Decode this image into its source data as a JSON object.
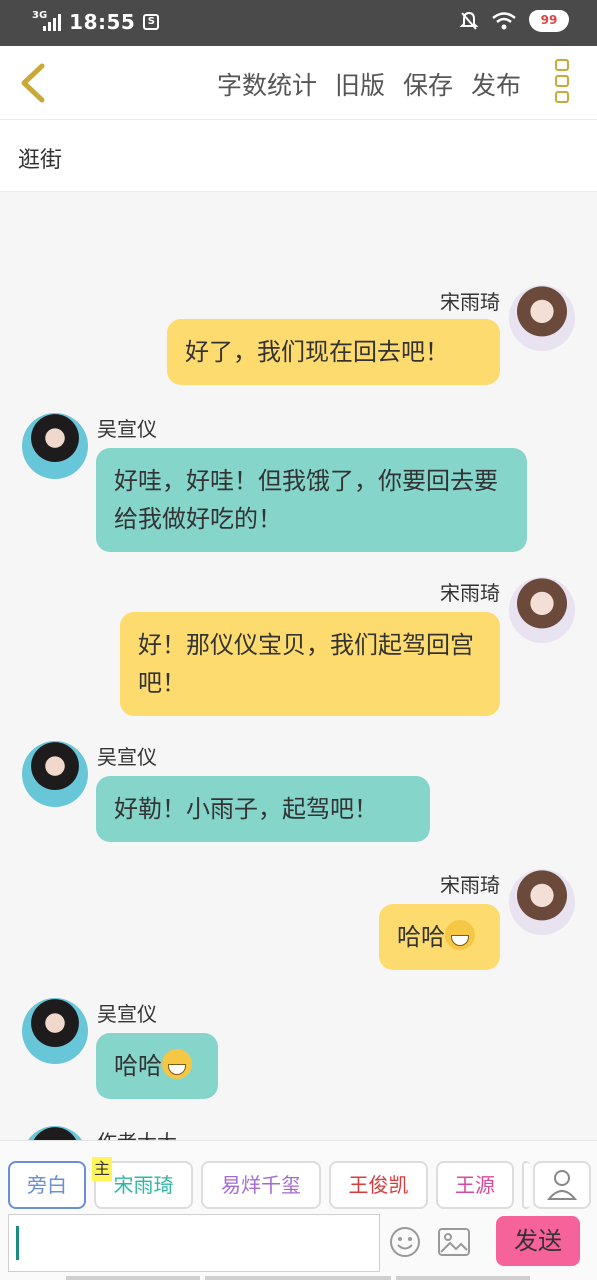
{
  "status_bar": {
    "network": "3G",
    "time": "18:55",
    "battery": "99"
  },
  "topbar": {
    "links": [
      "字数统计",
      "旧版",
      "保存",
      "发布"
    ]
  },
  "title": "逛街",
  "messages": [
    {
      "side": "right",
      "name": "宋雨琦",
      "text": "好了，我们现在回去吧！"
    },
    {
      "side": "left",
      "name": "吴宣仪",
      "text": "好哇，好哇！但我饿了，你要回去要给我做好吃的！"
    },
    {
      "side": "right",
      "name": "宋雨琦",
      "text": "好！那仪仪宝贝，我们起驾回宫吧！"
    },
    {
      "side": "left",
      "name": "吴宣仪",
      "text": "好勒！小雨子，起驾吧！"
    },
    {
      "side": "right",
      "name": "宋雨琦",
      "text": "哈哈"
    },
    {
      "side": "left",
      "name": "吴宣仪",
      "text": "哈哈"
    },
    {
      "side": "left",
      "name": "作者大大",
      "text": ""
    }
  ],
  "roles": {
    "narration": "旁白",
    "main_tag": "主",
    "items": [
      "宋雨琦",
      "易烊千玺",
      "王俊凯",
      "王源"
    ],
    "colors": {
      "narration": "#6a8fd8",
      "宋雨琦": "#2eb7a6",
      "易烊千玺": "#a56ad1",
      "王俊凯": "#d93a3a",
      "王源": "#d94a9e"
    }
  },
  "input": {
    "send_label": "发送",
    "value": ""
  },
  "icons": {
    "back": "chevron-left-icon",
    "more": "more-vertical-icon",
    "emoji": "emoji-icon",
    "image": "image-icon",
    "user": "user-icon"
  }
}
